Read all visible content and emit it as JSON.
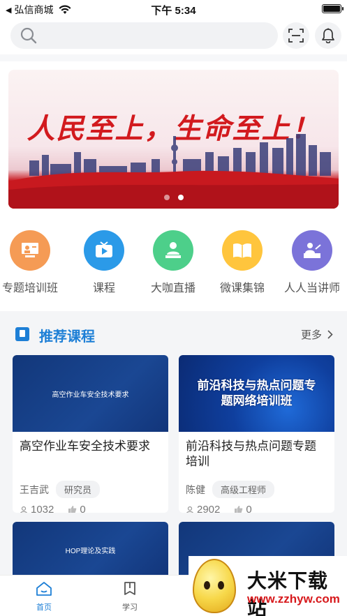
{
  "status_bar": {
    "back_indicator": "◀",
    "carrier": "弘信商城",
    "time": "下午 5:34"
  },
  "search": {
    "placeholder": ""
  },
  "banner": {
    "title": "人民至上，生命至上！",
    "dots": 2,
    "active_dot": 1
  },
  "categories": [
    {
      "label": "专题培训班",
      "icon": "training-class-icon",
      "color": "#f59b55"
    },
    {
      "label": "课程",
      "icon": "tv-play-icon",
      "color": "#2b9ae8"
    },
    {
      "label": "大咖直播",
      "icon": "live-speaker-icon",
      "color": "#4dcf8a"
    },
    {
      "label": "微课集锦",
      "icon": "open-book-icon",
      "color": "#ffc53d"
    },
    {
      "label": "人人当讲师",
      "icon": "lecturer-podium-icon",
      "color": "#7b73d9"
    }
  ],
  "recommend": {
    "title": "推荐课程",
    "more": "更多"
  },
  "courses": [
    {
      "thumb_text": "高空作业车安全技术要求",
      "title": "高空作业车安全技术要求",
      "author": "王吉武",
      "role": "研究员",
      "views": "1032",
      "likes": "0"
    },
    {
      "thumb_text": "前沿科技与热点问题专题网络培训班",
      "title": "前沿科技与热点问题专题培训",
      "author": "陈健",
      "role": "高级工程师",
      "views": "2902",
      "likes": "0"
    }
  ],
  "courses_row2": [
    {
      "thumb_text": "HOP理论及实践"
    },
    {
      "thumb_text": ""
    }
  ],
  "tabs": [
    {
      "label": "首页",
      "icon": "home-icon",
      "active": true
    },
    {
      "label": "学习",
      "icon": "study-book-icon",
      "active": false
    }
  ],
  "watermark": {
    "title": "大米下载站",
    "url": "www.zzhyw.com"
  },
  "colors": {
    "accent": "#1d7fd6",
    "banner_red": "#d21a1e"
  }
}
